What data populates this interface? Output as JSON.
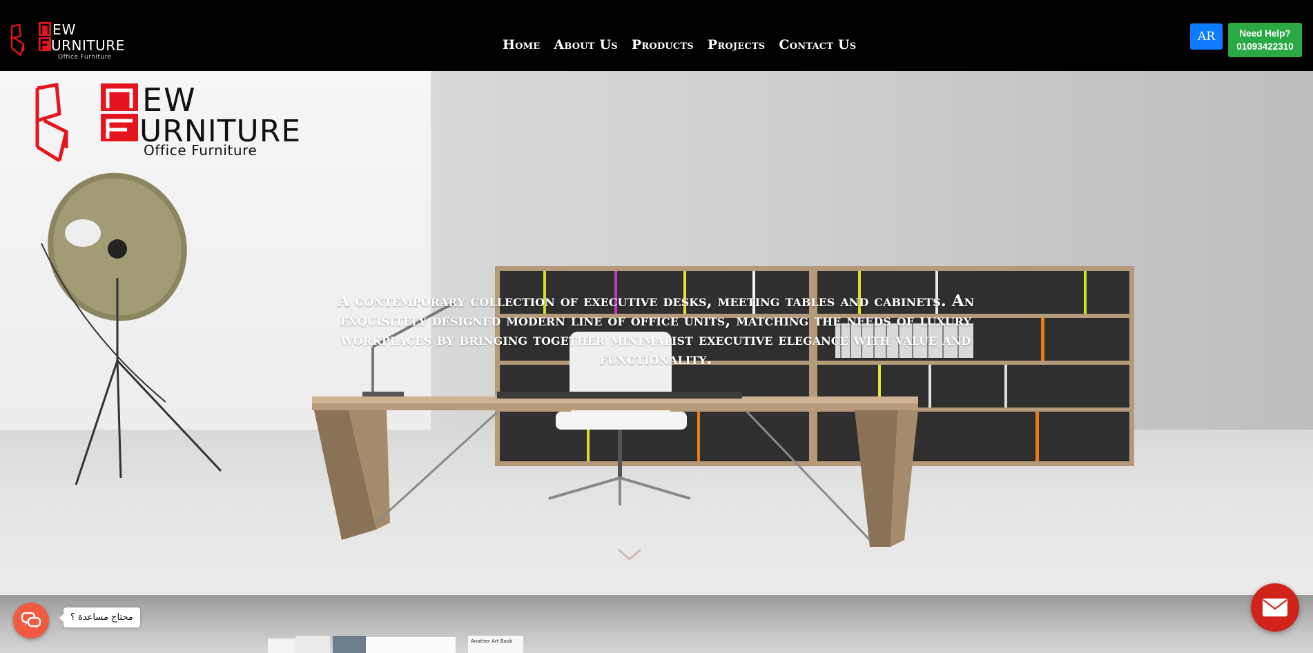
{
  "brand": {
    "name_line1": "NEW",
    "name_line2": "FURNITURE",
    "tagline": "Office Furniture",
    "accent": "#e4151f"
  },
  "nav": {
    "items": [
      {
        "label": "Home"
      },
      {
        "label": "About Us"
      },
      {
        "label": "Products"
      },
      {
        "label": "Projects"
      },
      {
        "label": "Contact Us"
      }
    ]
  },
  "header": {
    "lang_button": "AR",
    "help_line1": "Need Help?",
    "help_line2": "01093422310",
    "lang_color": "#0d7bff",
    "help_color": "#2aa845"
  },
  "hero": {
    "text": "A contemporary collection of executive desks, meeting tables and cabinets. An exquisitely designed modern line of office units, matching the needs of luxury workplaces by bringing together minimalist executive elegance with value and functionality."
  },
  "chat": {
    "tooltip": "محتاج مساعدة ؟",
    "color": "#ef5a41",
    "icon": "chat-bubbles-icon"
  },
  "mail": {
    "color": "#d0241b",
    "icon": "envelope-icon"
  },
  "books": {
    "cover_text": "Another Art Book"
  }
}
